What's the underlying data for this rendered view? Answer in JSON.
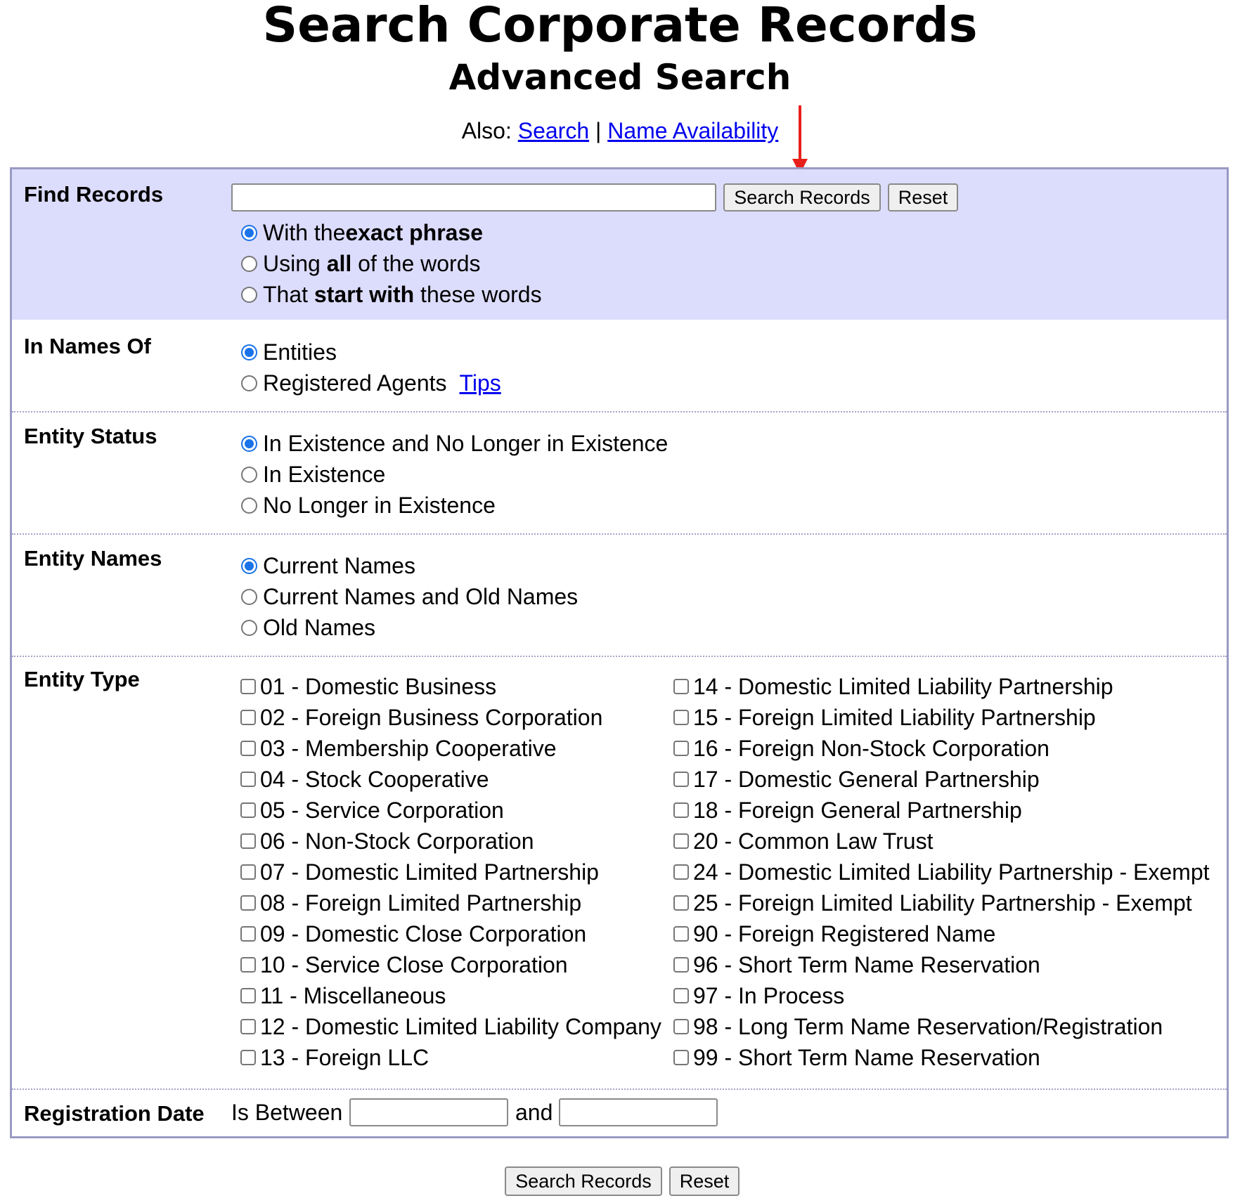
{
  "header": {
    "title": "Search Corporate Records",
    "subtitle": "Advanced Search",
    "also_prefix": "Also:",
    "link_search": "Search",
    "separator": "|",
    "link_name_availability": "Name Availability"
  },
  "find_records": {
    "label": "Find Records",
    "input_value": "",
    "search_button": "Search Records",
    "reset_button": "Reset",
    "options": [
      {
        "pre": "With the ",
        "bold": "exact phrase",
        "post": "",
        "checked": true
      },
      {
        "pre": "Using ",
        "bold": "all",
        "post": " of the words",
        "checked": false
      },
      {
        "pre": "That ",
        "bold": "start with",
        "post": " these words",
        "checked": false
      }
    ]
  },
  "names_of": {
    "label": "In Names Of",
    "options": [
      {
        "text": "Entities",
        "checked": true
      },
      {
        "text": "Registered Agents",
        "checked": false
      }
    ],
    "tips_link": "Tips"
  },
  "entity_status": {
    "label": "Entity Status",
    "options": [
      {
        "text": "In Existence and No Longer in Existence",
        "checked": true
      },
      {
        "text": "In Existence",
        "checked": false
      },
      {
        "text": "No Longer in Existence",
        "checked": false
      }
    ]
  },
  "entity_names": {
    "label": "Entity Names",
    "options": [
      {
        "text": "Current Names",
        "checked": true
      },
      {
        "text": "Current Names and Old Names",
        "checked": false
      },
      {
        "text": "Old Names",
        "checked": false
      }
    ]
  },
  "entity_type": {
    "label": "Entity Type",
    "left": [
      "01 - Domestic Business",
      "02 - Foreign Business Corporation",
      "03 - Membership Cooperative",
      "04 - Stock Cooperative",
      "05 - Service Corporation",
      "06 - Non-Stock Corporation",
      "07 - Domestic Limited Partnership",
      "08 - Foreign Limited Partnership",
      "09 - Domestic Close Corporation",
      "10 - Service Close Corporation",
      "11 - Miscellaneous",
      "12 - Domestic Limited Liability Company",
      "13 - Foreign LLC"
    ],
    "right": [
      "14 - Domestic Limited Liability Partnership",
      "15 - Foreign Limited Liability Partnership",
      "16 - Foreign Non-Stock Corporation",
      "17 - Domestic General Partnership",
      "18 - Foreign General Partnership",
      "20 - Common Law Trust",
      "24 - Domestic Limited Liability Partnership - Exempt",
      "25 - Foreign Limited Liability Partnership - Exempt",
      "90 - Foreign Registered Name",
      "96 - Short Term Name Reservation",
      "97 - In Process",
      "98 - Long Term Name Reservation/Registration",
      "99 - Short Term Name Reservation"
    ]
  },
  "registration_date": {
    "label": "Registration Date",
    "between_text": "Is Between",
    "and_text": "and",
    "from_value": "",
    "to_value": ""
  },
  "footer": {
    "search_button": "Search Records",
    "reset_button": "Reset"
  }
}
